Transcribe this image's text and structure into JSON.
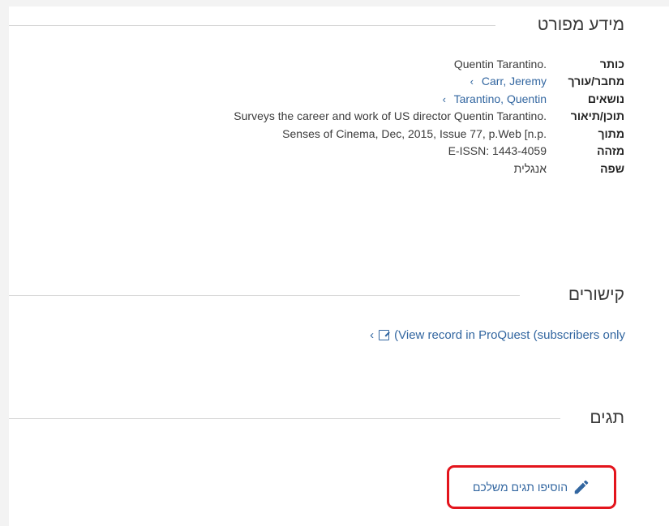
{
  "details_section": {
    "title": "מידע מפורט",
    "rows": [
      {
        "label": "כותר",
        "value": "Quentin Tarantino.",
        "link": false
      },
      {
        "label": "מחבר/עורך",
        "value": "Carr, Jeremy",
        "link": true
      },
      {
        "label": "נושאים",
        "value": "Tarantino, Quentin",
        "link": true
      },
      {
        "label": "תוכן/תיאור",
        "value": "Surveys the career and work of US director Quentin Tarantino.",
        "link": false
      },
      {
        "label": "מתוך",
        "value": "Senses of Cinema, Dec, 2015, Issue 77, p.Web [n.p.",
        "link": false
      },
      {
        "label": "מזהה",
        "value_prefix": "E-ISSN:",
        "value": "1443-4059",
        "link": false
      },
      {
        "label": "שפה",
        "value": "אנגלית",
        "link": false
      }
    ]
  },
  "links_section": {
    "title": "קישורים",
    "link_text": "(View record in ProQuest (subscribers only"
  },
  "tags_section": {
    "title": "תגים",
    "add_tags_label": "הוסיפו תגים משלכם"
  },
  "icons": {
    "chevron": "chevron-left-icon",
    "external": "external-link-icon",
    "pencil": "pencil-icon"
  },
  "colors": {
    "link": "#3266a0",
    "highlight_border": "#e3141c"
  }
}
